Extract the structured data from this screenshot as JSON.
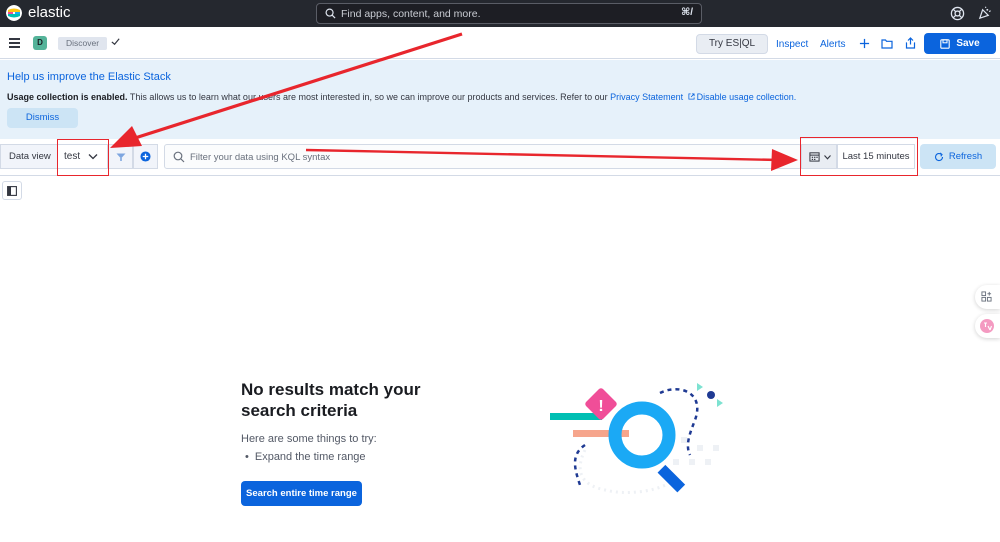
{
  "topbar": {
    "brand": "elastic",
    "search_placeholder": "Find apps, content, and more.",
    "search_shortcut": "⌘/"
  },
  "appbar": {
    "app_badge": "D",
    "breadcrumb": "Discover",
    "try_esql": "Try ES|QL",
    "inspect": "Inspect",
    "alerts": "Alerts",
    "save": "Save"
  },
  "callout": {
    "title": "Help us improve the Elastic Stack",
    "body_bold": "Usage collection is enabled.",
    "body_text": " This allows us to learn what our users are most interested in, so we can improve our products and services. Refer to our ",
    "privacy_link": "Privacy Statement",
    "disable_link": "Disable usage collection.",
    "dismiss": "Dismiss"
  },
  "querybar": {
    "data_view_label": "Data view",
    "data_view_value": "test",
    "kql_placeholder": "Filter your data using KQL syntax",
    "time_range": "Last 15 minutes",
    "refresh": "Refresh"
  },
  "empty_state": {
    "title": "No results match your search criteria",
    "subtitle": "Here are some things to try:",
    "suggestion": "Expand the time range",
    "action": "Search entire time range"
  },
  "colors": {
    "primary": "#0b64dd",
    "header_dark": "#25282f",
    "callout_bg": "#e6f1fa",
    "annotation_red": "#e8262d"
  },
  "icons": {
    "help": "help-icon",
    "notifications": "newsfeed-icon",
    "menu": "hamburger-icon",
    "add": "plus-icon",
    "open": "folder-icon",
    "share": "share-icon",
    "save": "save-icon",
    "filter": "filter-icon",
    "add_filter": "plus-circle-icon",
    "calendar": "calendar-icon",
    "refresh": "refresh-icon"
  }
}
